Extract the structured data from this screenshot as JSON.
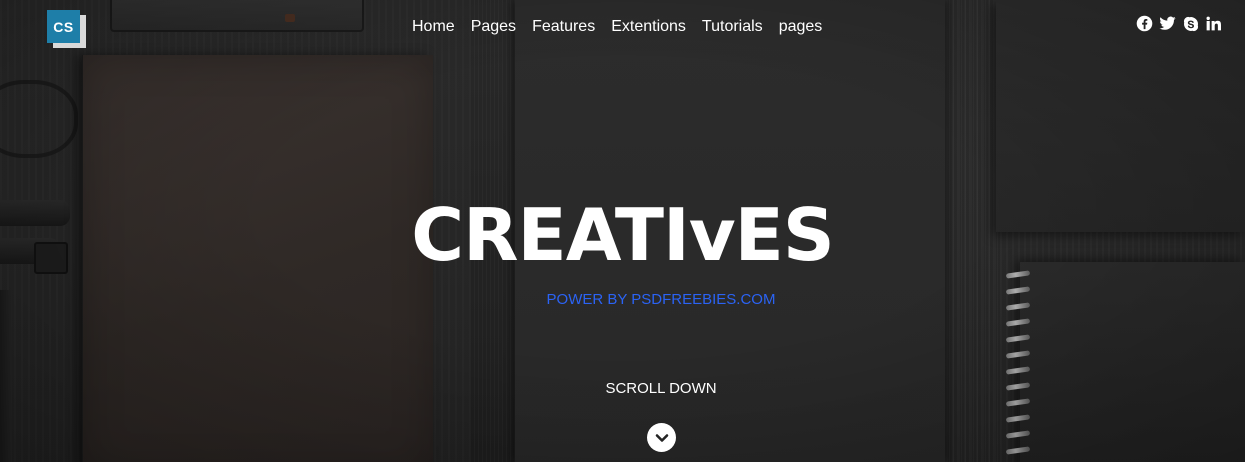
{
  "brand": {
    "logo_text": "CS",
    "accent_color": "#1e7ea8"
  },
  "nav": {
    "items": [
      {
        "label": "Home"
      },
      {
        "label": "Pages"
      },
      {
        "label": "Features"
      },
      {
        "label": "Extentions"
      },
      {
        "label": "Tutorials"
      },
      {
        "label": "pages"
      }
    ]
  },
  "social": {
    "icons": [
      "facebook-icon",
      "twitter-icon",
      "skype-icon",
      "linkedin-icon"
    ]
  },
  "hero": {
    "title": "CREATIvES",
    "subtitle": "POWER BY PSDFREEBIES.COM",
    "subtitle_color": "#2b63f4",
    "scroll_label": "SCROLL DOWN",
    "scroll_icon": "chevron-down-icon"
  }
}
